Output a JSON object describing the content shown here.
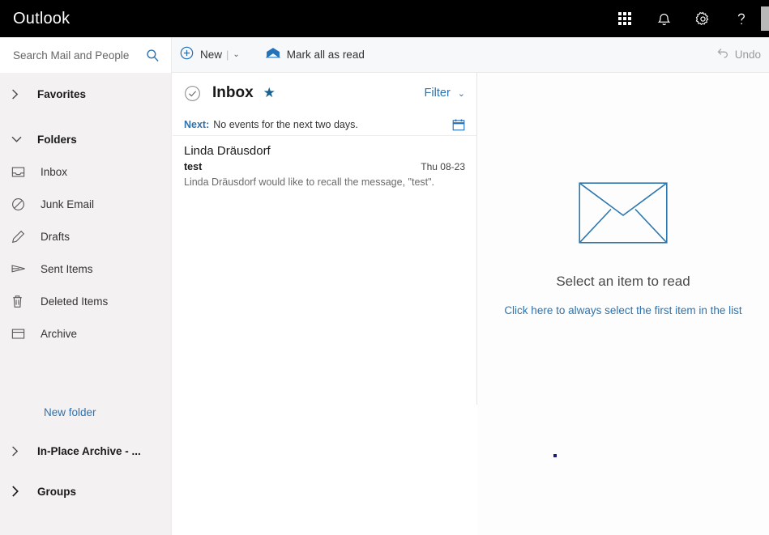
{
  "header": {
    "brand": "Outlook",
    "icons": [
      {
        "name": "app-launcher-icon",
        "label": "App launcher"
      },
      {
        "name": "notifications-bell-icon",
        "label": "Notifications"
      },
      {
        "name": "settings-gear-icon",
        "label": "Settings"
      },
      {
        "name": "help-question-icon",
        "label": "Help"
      }
    ]
  },
  "search": {
    "placeholder": "Search Mail and People",
    "value": "",
    "icon": "search-icon"
  },
  "commandbar": {
    "new_label": "New",
    "new_separator": "|",
    "new_chevron": "⌄",
    "mark_all_read_label": "Mark all as read",
    "undo_label": "Undo"
  },
  "sidebar": {
    "favorites": {
      "label": "Favorites",
      "twisty": "›"
    },
    "folders_group": {
      "label": "Folders",
      "twisty": "⌄"
    },
    "folders": [
      {
        "label": "Inbox",
        "icon": "inbox-icon"
      },
      {
        "label": "Junk Email",
        "icon": "block-circle-icon"
      },
      {
        "label": "Drafts",
        "icon": "pencil-icon"
      },
      {
        "label": "Sent Items",
        "icon": "paper-plane-icon"
      },
      {
        "label": "Deleted Items",
        "icon": "trash-icon"
      },
      {
        "label": "Archive",
        "icon": "archive-box-icon"
      }
    ],
    "new_folder_label": "New folder",
    "in_place_archive": {
      "label": "In-Place Archive - ...",
      "twisty": "›"
    },
    "groups": {
      "label": "Groups",
      "twisty": "›"
    }
  },
  "list": {
    "title": "Inbox",
    "star": "★",
    "filter_label": "Filter",
    "filter_chevron": "⌄",
    "next_label": "Next:",
    "next_text": "No events for the next two days.",
    "messages": [
      {
        "from": "Linda Dräusdorf",
        "subject": "test",
        "date": "Thu 08-23",
        "preview": "Linda Dräusdorf would like to recall the message, \"test\"."
      }
    ]
  },
  "reading_pane": {
    "empty_icon": "envelope-icon",
    "empty_title": "Select an item to read",
    "empty_link": "Click here to always select the first item in the list"
  },
  "colors": {
    "header_bg": "#000000",
    "accent_blue": "#2e72ad",
    "sidebar_bg": "#f4f1f3",
    "commandbar_bg": "#f6f8fa"
  }
}
